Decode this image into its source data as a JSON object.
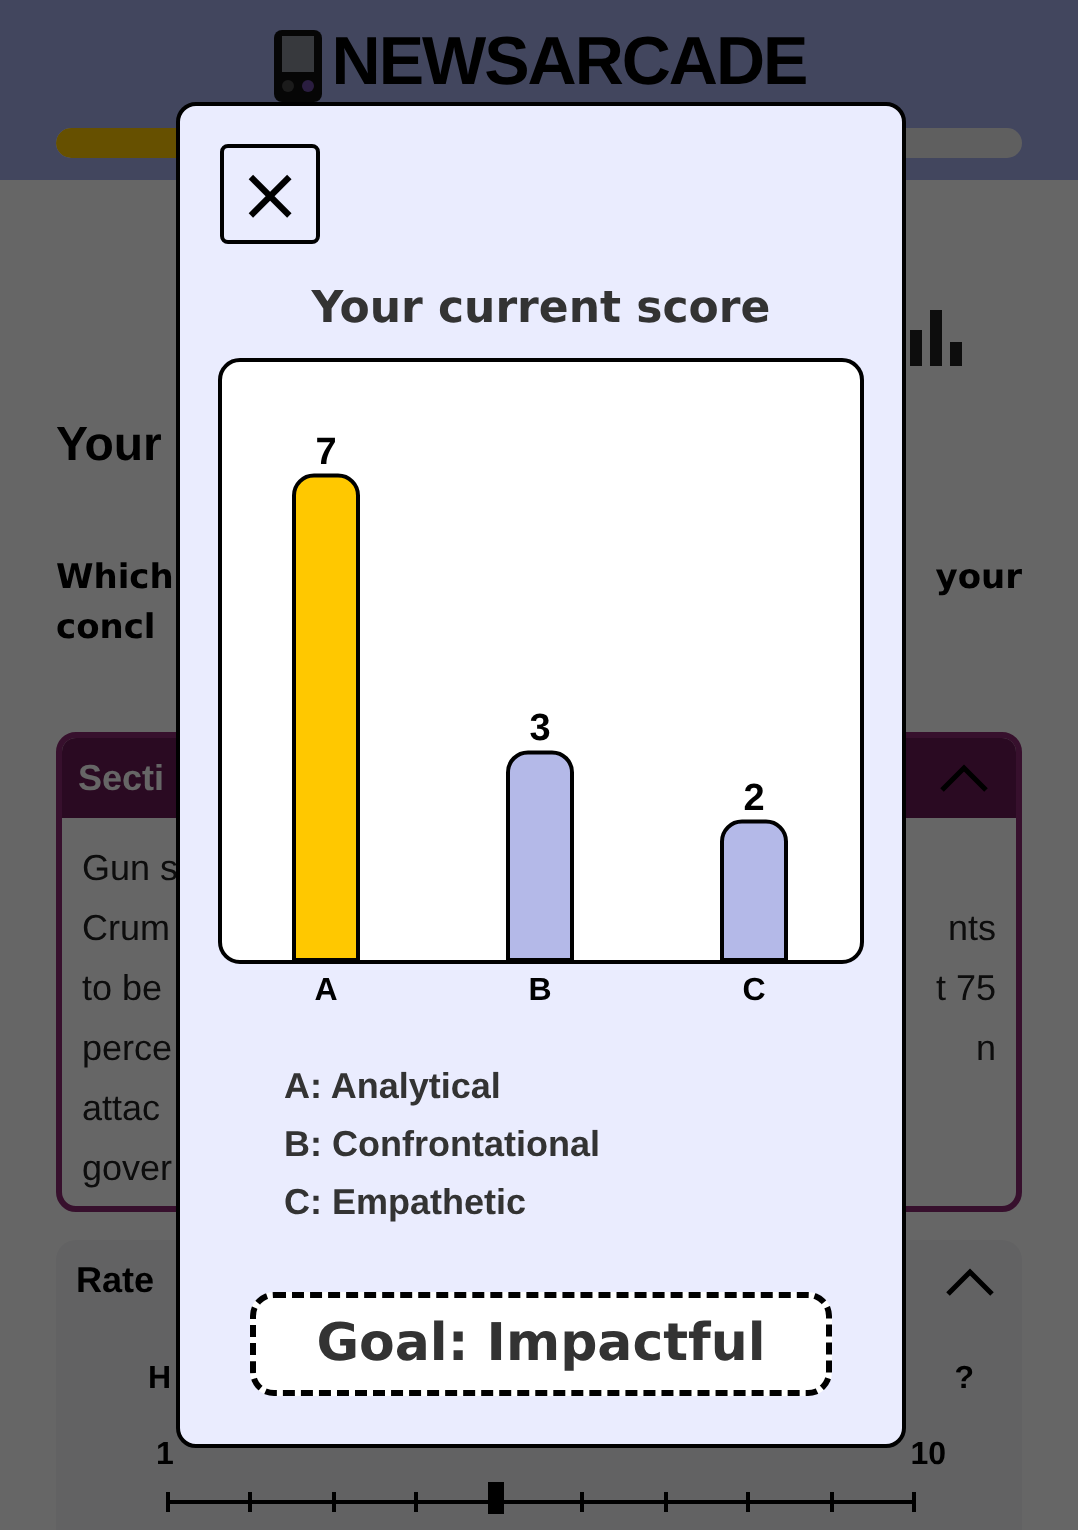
{
  "header": {
    "logo": "NEWSARCADE",
    "progress": {
      "level": 0.3
    }
  },
  "page": {
    "heading": "Your",
    "question": [
      {
        "left": "Which",
        "right": "your"
      },
      {
        "left": "concl"
      }
    ],
    "section": {
      "title": "Secti",
      "expanded": true,
      "lines": [
        {
          "left": "Gun s"
        },
        {
          "left": "Crum",
          "right": "nts"
        },
        {
          "left": "to be",
          "right": "t 75"
        },
        {
          "left": "perce",
          "right": "n"
        },
        {
          "left": "attac"
        },
        {
          "left": "gover"
        }
      ]
    },
    "rate": {
      "title": "Rate",
      "expanded": true,
      "prompt": {
        "left": "H",
        "right": "?"
      },
      "min": "1",
      "max": "10",
      "slider": {
        "level": 0.44
      }
    }
  },
  "modal": {
    "close": "×",
    "title": "Your current score",
    "chart_data": {
      "type": "bar",
      "categories": [
        "A",
        "B",
        "C"
      ],
      "stacked": true,
      "data_labels": true,
      "series": [
        {
          "color": "#ffc800",
          "values": [
            7,
            null,
            null
          ]
        },
        {
          "color": "#b4b9e8",
          "values": [
            null,
            3,
            2
          ]
        }
      ]
    },
    "legend": [
      "A: Analytical",
      "B: Confrontational",
      "C: Empathetic"
    ],
    "goal": "Goal: Impactful"
  }
}
